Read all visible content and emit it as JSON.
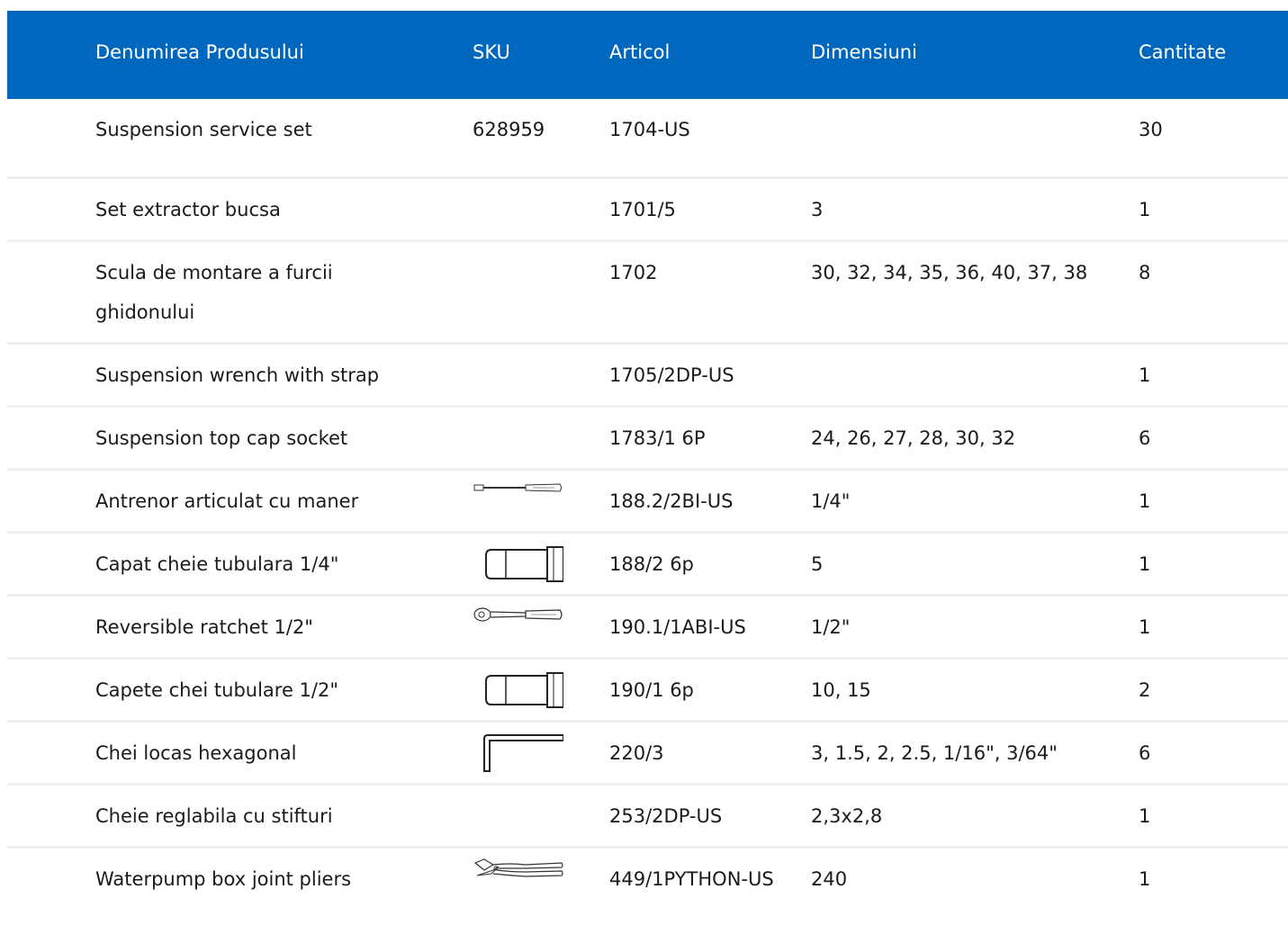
{
  "header": {
    "name": "Denumirea Produsului",
    "sku": "SKU",
    "article": "Articol",
    "dimensions": "Dimensiuni",
    "quantity": "Cantitate"
  },
  "rows": [
    {
      "name": "Suspension service set",
      "sku": "628959",
      "article": "1704-US",
      "dimensions": "",
      "quantity": "30",
      "icon": ""
    },
    {
      "name": "Set extractor bucsa",
      "sku": "",
      "article": "1701/5",
      "dimensions": "3",
      "quantity": "1",
      "icon": ""
    },
    {
      "name": "Scula de montare a furcii ghidonului",
      "sku": "",
      "article": "1702",
      "dimensions": "30, 32, 34, 35, 36, 40, 37, 38",
      "quantity": "8",
      "icon": ""
    },
    {
      "name": "Suspension wrench with strap",
      "sku": "",
      "article": "1705/2DP-US",
      "dimensions": "",
      "quantity": "1",
      "icon": ""
    },
    {
      "name": "Suspension top cap socket",
      "sku": "",
      "article": "1783/1 6P",
      "dimensions": "24, 26, 27, 28, 30, 32",
      "quantity": "6",
      "icon": ""
    },
    {
      "name": "Antrenor articulat cu maner",
      "sku": "",
      "article": "188.2/2BI-US",
      "dimensions": "1/4\"",
      "quantity": "1",
      "icon": "flex-handle-icon"
    },
    {
      "name": "Capat cheie tubulara 1/4\"",
      "sku": "",
      "article": "188/2 6p",
      "dimensions": "5",
      "quantity": "1",
      "icon": "socket-icon"
    },
    {
      "name": "Reversible ratchet 1/2\"",
      "sku": "",
      "article": "190.1/1ABI-US",
      "dimensions": "1/2\"",
      "quantity": "1",
      "icon": "ratchet-icon"
    },
    {
      "name": "Capete chei tubulare 1/2\"",
      "sku": "",
      "article": "190/1 6p",
      "dimensions": "10, 15",
      "quantity": "2",
      "icon": "socket-icon"
    },
    {
      "name": "Chei locas hexagonal",
      "sku": "",
      "article": "220/3",
      "dimensions": "3, 1.5, 2, 2.5, 1/16\", 3/64\"",
      "quantity": "6",
      "icon": "hex-key-icon"
    },
    {
      "name": "Cheie reglabila cu stifturi",
      "sku": "",
      "article": "253/2DP-US",
      "dimensions": "2,3x2,8",
      "quantity": "1",
      "icon": ""
    },
    {
      "name": "Waterpump box joint pliers",
      "sku": "",
      "article": "449/1PYTHON-US",
      "dimensions": "240",
      "quantity": "1",
      "icon": "pliers-icon"
    }
  ],
  "colors": {
    "header_bg": "#0067be",
    "header_text": "#ffffff",
    "divider": "#eeeeee",
    "body_text": "#1a1a1a"
  }
}
